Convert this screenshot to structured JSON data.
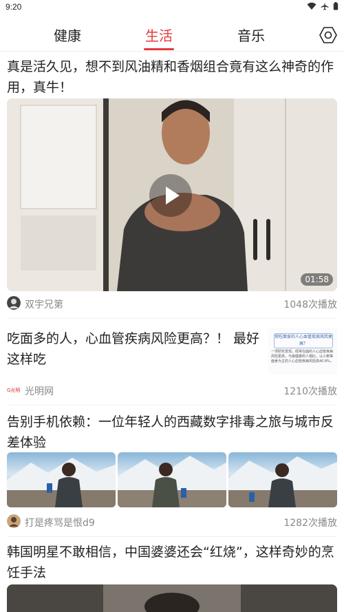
{
  "status": {
    "time": "9:20"
  },
  "tabs": [
    {
      "label": "健康"
    },
    {
      "label": "生活",
      "active": true
    },
    {
      "label": "音乐"
    }
  ],
  "articles": [
    {
      "title": "真是活久见，想不到风油精和香烟组合竟有这么神奇的作用，真牛！",
      "duration": "01:58",
      "source": "双宇兄第",
      "plays": "1048次播放"
    },
    {
      "title": "吃面多的人，心血管疾病风险更高？！ 最好这样吃",
      "thumb_heading": "常吃面食的人心血管疾病风险更高？",
      "thumb_text": "一项研究发现，经常在面的人心血管疾病风险更高，与最健康的人相比，以小麦等面食为主的人心血管疾病风险高40.8%。",
      "source": "光明网",
      "plays": "1210次播放"
    },
    {
      "title": "告别手机依赖：一位年轻人的西藏数字排毒之旅与城市反差体验",
      "source": "打是疼骂是恨d9",
      "plays": "1282次播放"
    },
    {
      "title": "韩国明星不敢相信，中国婆婆还会“红烧”，这样奇妙的烹饪手法"
    }
  ],
  "colors": {
    "accent": "#e5383b",
    "muted": "#888888"
  }
}
